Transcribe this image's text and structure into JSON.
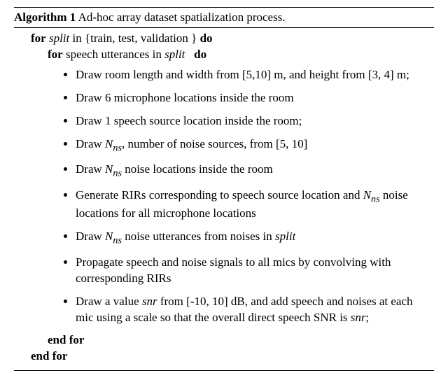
{
  "algo": {
    "number_label": "Algorithm 1",
    "title": "Ad-hoc array dataset spatialization process.",
    "for1_kw": "for",
    "for1_var": "split",
    "for1_in": " in {train, test, validation } ",
    "do_kw": "do",
    "for2_kw": "for",
    "for2_text": " speech utterances in ",
    "for2_var": "split",
    "steps": [
      "Draw room length and width from [5,10] m, and height from [3, 4] m;",
      "Draw 6 microphone locations inside the room",
      "Draw 1 speech source location inside the room;",
      "Draw N_ns, number of noise sources, from [5, 10]",
      "Draw N_ns noise locations inside the room",
      "Generate RIRs corresponding to speech source location and N_ns noise locations for all microphone locations",
      "Draw N_ns noise utterances from noises in split",
      "Propagate speech and noise signals to all mics by convolving with corresponding RIRs",
      "Draw a value snr from [-10, 10] dB, and add speech and noises at each mic using a scale so that the overall direct speech SNR is snr;"
    ],
    "endfor_kw": "end for"
  },
  "step_html": {
    "s0": "Draw room length and width from [5,10] m, and height from [3, 4] m;",
    "s1": "Draw 6 microphone locations inside the room",
    "s2": "Draw 1 speech source location inside the room;",
    "s3_a": "Draw ",
    "s3_var": "N",
    "s3_sub": "ns",
    "s3_b": ", number of noise sources, from [5, 10]",
    "s4_a": "Draw ",
    "s4_var": "N",
    "s4_sub": "ns",
    "s4_b": " noise locations inside the room",
    "s5_a": "Generate RIRs corresponding to speech source location and ",
    "s5_var": "N",
    "s5_sub": "ns",
    "s5_b": " noise locations for all microphone locations",
    "s6_a": "Draw ",
    "s6_var": "N",
    "s6_sub": "ns",
    "s6_b": " noise utterances from noises in ",
    "s6_split": "split",
    "s7": "Propagate speech and noise signals to all mics by convolving with corresponding RIRs",
    "s8_a": "Draw a value ",
    "s8_snr1": "snr",
    "s8_b": " from [-10, 10] dB, and add speech and noises at each mic using a scale so that the overall direct speech SNR is ",
    "s8_snr2": "snr",
    "s8_c": ";"
  }
}
